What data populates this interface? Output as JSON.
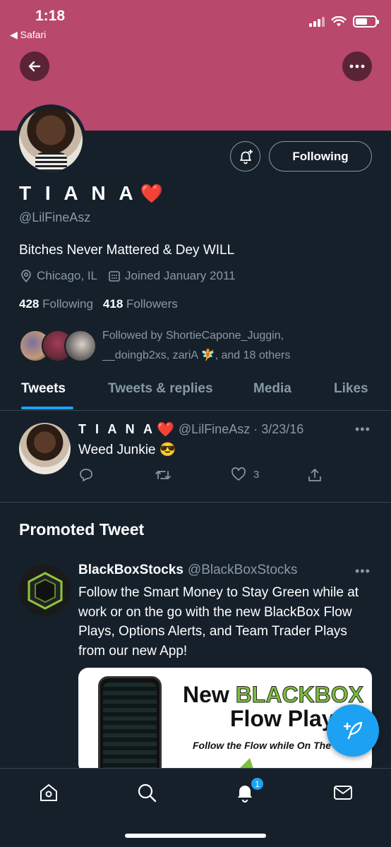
{
  "status_bar": {
    "time": "1:18",
    "back_app": "◀ Safari"
  },
  "colors": {
    "banner": "#b8486c",
    "background": "#15202b",
    "accent": "#1da1f2",
    "muted": "#8899a6",
    "heart": "#e0245e"
  },
  "header": {
    "back_icon": "arrow-left-icon",
    "more_icon": "more-horizontal-icon"
  },
  "profile": {
    "name": "T I A N A",
    "heart": "❤️",
    "handle": "@LilFineAsz",
    "bio": "Bitches Never Mattered & Dey WILL",
    "location": "Chicago, IL",
    "joined": "Joined January 2011",
    "following_count": "428",
    "following_label": "Following",
    "followers_count": "418",
    "followers_label": "Followers",
    "followed_by": "Followed by ShortieCapone_Juggin, __doingb2xs, zariA 🧚, and 18 others",
    "follow_button": "Following"
  },
  "tabs": [
    {
      "label": "Tweets",
      "active": true
    },
    {
      "label": "Tweets & replies",
      "active": false
    },
    {
      "label": "Media",
      "active": false
    },
    {
      "label": "Likes",
      "active": false
    }
  ],
  "tweet": {
    "name": "T I A N A",
    "heart": "❤️",
    "handle_date": "@LilFineAsz · 3/23/16",
    "text": "Weed Junkie 😎",
    "like_count": "3",
    "more": "•••"
  },
  "promoted": {
    "section_title": "Promoted Tweet",
    "name": "BlackBoxStocks",
    "handle": "@BlackBoxStocks",
    "text": "Follow the Smart Money to Stay Green while at work or on the go with the new BlackBox Flow Plays, Options Alerts, and Team Trader Plays from our new App!",
    "more": "•••",
    "card": {
      "line1_prefix": "New ",
      "line1_brand": "BLACKBOX",
      "line2": "Flow Plays",
      "line3": "Follow the Flow while On The Go!"
    }
  },
  "bottom_nav": {
    "notification_badge": "1"
  }
}
